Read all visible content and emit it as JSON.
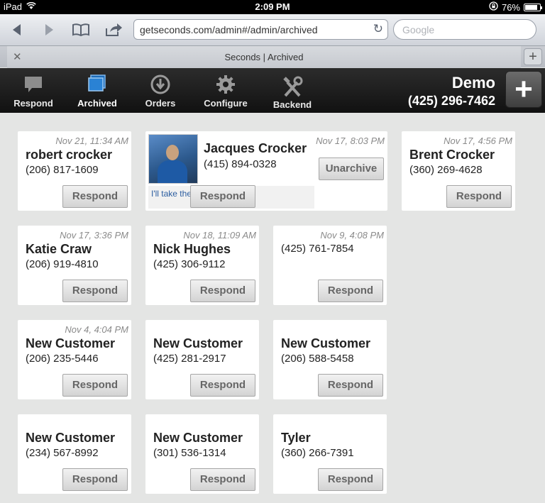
{
  "status": {
    "device": "iPad",
    "time": "2:09 PM",
    "battery": "76%",
    "battery_level": 0.76
  },
  "browser": {
    "url": "getseconds.com/admin#/admin/archived",
    "search_placeholder": "Google",
    "tab_title": "Seconds | Archived",
    "new_tab": "+"
  },
  "nav": {
    "respond": "Respond",
    "archived": "Archived",
    "orders": "Orders",
    "configure": "Configure",
    "backend": "Backend"
  },
  "brand": {
    "name": "Demo",
    "phone": "(425) 296-7462"
  },
  "cards": {
    "c1": {
      "time": "Nov 21, 11:34 AM",
      "name": "robert crocker",
      "phone": "(206) 817-1609",
      "button": "Respond"
    },
    "c2": {
      "time": "Nov 17, 8:03 PM",
      "name": "Jacques Crocker",
      "phone": "(415) 894-0328",
      "message": "I'll take the usual!",
      "unarchive": "Unarchive",
      "button": "Respond"
    },
    "c3": {
      "time": "Nov 17, 4:56 PM",
      "name": "Brent Crocker",
      "phone": "(360) 269-4628",
      "button": "Respond"
    },
    "c4": {
      "time": "Nov 17, 3:36 PM",
      "name": "Katie Craw",
      "phone": "(206) 919-4810",
      "button": "Respond"
    },
    "c5": {
      "time": "Nov 18, 11:09 AM",
      "name": "Nick Hughes",
      "phone": "(425) 306-9112",
      "button": "Respond"
    },
    "c6": {
      "time": "Nov 9, 4:08 PM",
      "phone": "(425) 761-7854",
      "button": "Respond"
    },
    "c7": {
      "time": "Nov 4, 4:04 PM",
      "name": "New Customer",
      "phone": "(206) 235-5446",
      "button": "Respond"
    },
    "c8": {
      "name": "New Customer",
      "phone": "(425) 281-2917",
      "button": "Respond"
    },
    "c9": {
      "name": "New Customer",
      "phone": "(206) 588-5458",
      "button": "Respond"
    },
    "c10": {
      "name": "New Customer",
      "phone": "(234) 567-8992",
      "button": "Respond"
    },
    "c11": {
      "name": "New Customer",
      "phone": "(301) 536-1314",
      "button": "Respond"
    },
    "c12": {
      "name": "Tyler",
      "phone": "(360) 266-7391",
      "button": "Respond"
    }
  }
}
